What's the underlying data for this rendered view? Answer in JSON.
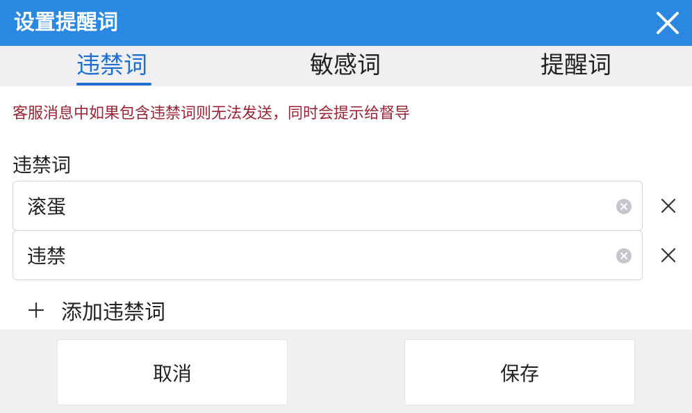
{
  "dialog": {
    "title": "设置提醒词"
  },
  "tabs": [
    {
      "label": "违禁词",
      "active": true
    },
    {
      "label": "敏感词",
      "active": false
    },
    {
      "label": "提醒词",
      "active": false
    }
  ],
  "notice": "客服消息中如果包含违禁词则无法发送，同时会提示给督导",
  "section_label": "违禁词",
  "words": [
    {
      "value": "滚蛋"
    },
    {
      "value": "违禁"
    }
  ],
  "add_label": "添加违禁词",
  "footer": {
    "cancel_label": "取消",
    "save_label": "保存"
  },
  "colors": {
    "titlebar": "#2b88e0",
    "accent": "#1f6fd1",
    "notice": "#9b2335"
  },
  "icons": {
    "close": "close-icon",
    "clear": "clear-circle-icon",
    "remove": "x-icon",
    "add": "plus-icon"
  }
}
